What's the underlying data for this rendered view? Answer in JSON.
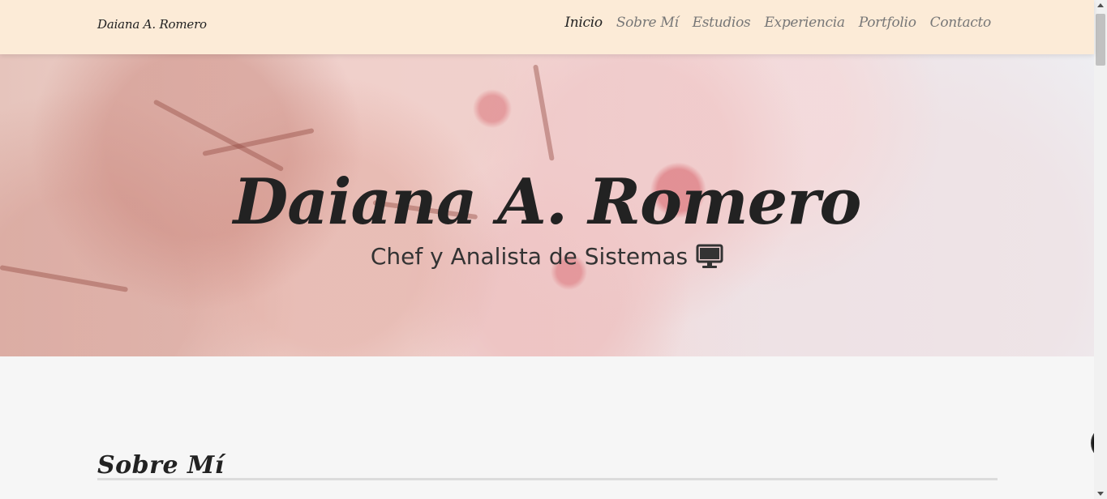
{
  "navbar": {
    "brand": "Daiana A. Romero",
    "links": [
      {
        "label": "Inicio",
        "active": true
      },
      {
        "label": "Sobre Mí",
        "active": false
      },
      {
        "label": "Estudios",
        "active": false
      },
      {
        "label": "Experiencia",
        "active": false
      },
      {
        "label": "Portfolio",
        "active": false
      },
      {
        "label": "Contacto",
        "active": false
      }
    ],
    "background": "#fcebd7"
  },
  "hero": {
    "title": "Daiana A. Romero",
    "subtitle": "Chef y Analista de Sistemas",
    "subtitle_icon": "monitor-icon",
    "background": "cherry-blossom-photo"
  },
  "about": {
    "title": "Sobre Mí"
  },
  "float_button": {
    "icon": "chevron-left-icon"
  },
  "colors": {
    "text_dark": "#222222",
    "nav_inactive": "#777777",
    "page_background": "#f6f6f6",
    "divider": "#dcdcdc"
  }
}
